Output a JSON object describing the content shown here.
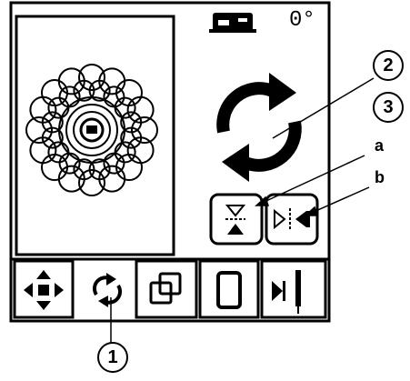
{
  "status": {
    "angle_value": "0",
    "angle_unit": "°",
    "machine_icon": "sewing-machine-icon"
  },
  "design_preview": {
    "icon": "circular-flower-embroidery-design"
  },
  "rotate_control": {
    "icon": "rotate-arrows-icon"
  },
  "mirror_buttons": [
    {
      "icon": "mirror-vertical-icon",
      "callout": "a"
    },
    {
      "icon": "mirror-horizontal-icon",
      "callout": "b"
    }
  ],
  "callouts": {
    "one": "1",
    "two": "2",
    "three": "3",
    "a": "a",
    "b": "b"
  },
  "tabs": [
    {
      "icon": "move-arrows-icon"
    },
    {
      "icon": "rotate-icon",
      "active": true
    },
    {
      "icon": "resize-icon"
    },
    {
      "icon": "hoop-icon"
    },
    {
      "icon": "needle-position-icon"
    }
  ]
}
